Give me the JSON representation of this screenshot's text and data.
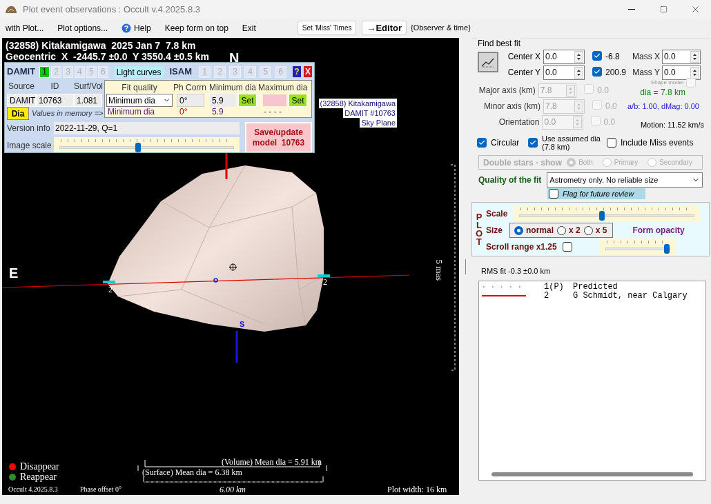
{
  "window": {
    "title": "Plot event observations : Occult v.4.2025.8.3"
  },
  "menu": [
    {
      "label": "with Plot...",
      "has_icon": false
    },
    {
      "label": "Plot options...",
      "has_icon": false
    },
    {
      "label": "Help",
      "has_icon": true
    },
    {
      "label": "Keep form on top",
      "has_icon": false
    },
    {
      "label": "Exit",
      "has_icon": false
    }
  ],
  "toolbar_buttons": [
    {
      "label": "Set 'Miss' Times",
      "bold": false
    },
    {
      "label": "→Editor",
      "bold": true
    }
  ],
  "observer_time_label": "{Observer & time}",
  "plot": {
    "header_lines": [
      "(32858) Kitakamigawa  2025 Jan 7  7.8 km",
      "Geocentric  X  -2445.7 ±0.0  Y 3550.4 ±0.5 km"
    ],
    "north": "N",
    "east": "E",
    "south": "S",
    "caption_lines": [
      "(32858) Kitakamigawa",
      "DAMIT #10763",
      "Sky Plane"
    ],
    "scale_side": "5 mas",
    "chord_labels": [
      "2",
      "2"
    ],
    "legend": [
      {
        "label": "Disappear",
        "color": "#ff0000"
      },
      {
        "label": "Reappear",
        "color": "#2e8b2e"
      }
    ],
    "volume_dia": "(Volume) Mean dia = 5.91 km",
    "surface_dia": "(Surface) Mean dia = 6.38 km",
    "version": "Occult 4.2025.8.3",
    "phase_offset": "Phase offset 0°",
    "scale_bar": "6.00 km",
    "plot_width": "Plot width: 16 km"
  },
  "shape_panel": {
    "damit_label": "DAMIT",
    "damit_models": [
      {
        "label": "1",
        "selected": true
      },
      {
        "label": "2",
        "selected": false
      },
      {
        "label": "3",
        "selected": false
      },
      {
        "label": "4",
        "selected": false
      },
      {
        "label": "5",
        "selected": false
      },
      {
        "label": "6",
        "selected": false
      }
    ],
    "light_curves": "Light curves",
    "isam_label": "ISAM",
    "isam_models": [
      {
        "label": "1",
        "selected": false
      },
      {
        "label": "2",
        "selected": false
      },
      {
        "label": "3",
        "selected": false
      },
      {
        "label": "4",
        "selected": false
      },
      {
        "label": "5",
        "selected": false
      },
      {
        "label": "6",
        "selected": false
      }
    ],
    "help": "?",
    "close": "X",
    "source": {
      "label": "Source",
      "value": "DAMIT"
    },
    "id": {
      "label": "ID",
      "value": "10763"
    },
    "surf_vol": {
      "label": "Surf/Vol",
      "value": "1.081"
    },
    "dia_button": "Dia",
    "memory_label": "Values in memory =>",
    "fit_quality": {
      "label": "Fit quality",
      "value": "Minimum dia",
      "memory": "Minimum dia"
    },
    "ph_corr": {
      "label": "Ph Corrn",
      "value": "0°",
      "memory": "0°"
    },
    "min_dia": {
      "label": "Minimum dia",
      "value": "5.9",
      "button": "Set",
      "memory": "5.9"
    },
    "max_dia": {
      "label": "Maximum dia",
      "button": "Set",
      "memory": "- - - -"
    },
    "version_info": {
      "label": "Version info",
      "value": "2022-11-29, Q=1"
    },
    "image_scale": {
      "label": "Image scale",
      "level": 0.45
    },
    "save_button": [
      "Save/update",
      "model  10763"
    ]
  },
  "fit": {
    "title": "Find best fit",
    "parameters": [
      {
        "label": "Center X",
        "value": "0.0",
        "checked": true,
        "result": "-6.8",
        "disabled": false
      },
      {
        "label": "Center Y",
        "value": "0.0",
        "checked": true,
        "result": "200.9",
        "disabled": false
      },
      {
        "label": "Major axis (km)",
        "value": "7.8",
        "checked": false,
        "result": "0.0",
        "disabled": true
      },
      {
        "label": "Minor axis (km)",
        "value": "7.8",
        "checked": false,
        "result": "0.0",
        "disabled": true
      },
      {
        "label": "Orientation",
        "value": "0.0",
        "checked": false,
        "result": "0.0",
        "disabled": true
      }
    ],
    "mass_fields": [
      {
        "label": "Mass X",
        "value": "0.0"
      },
      {
        "label": "Mass Y",
        "value": "0.0"
      }
    ],
    "shape_model": {
      "label": "Shape model",
      "checked": false
    },
    "dia_info": "dia = 7.8 km",
    "ab_info": "a/b: 1.00, dMag: 0.00",
    "motion": "Motion: 11.52 km/s",
    "options": [
      {
        "label": "Circular",
        "checked": true
      },
      {
        "label": "Use assumed dia (7.8 km)",
        "checked": true
      },
      {
        "label": "Include Miss events",
        "checked": false
      }
    ],
    "double_stars": {
      "label": "Double stars - show",
      "options": [
        {
          "label": "Both",
          "selected": true
        },
        {
          "label": "Primary",
          "selected": false
        },
        {
          "label": "Secondary",
          "selected": false
        }
      ]
    },
    "quality": {
      "label": "Quality of the fit",
      "value": "Astrometry only. No reliable size"
    },
    "flag": {
      "label": "Flag for future review",
      "checked": false
    }
  },
  "plot_controls": {
    "title": "PLOT",
    "scale": {
      "label": "Scale",
      "level": 0.47
    },
    "size": {
      "label": "Size",
      "options": [
        {
          "label": "normal",
          "selected": true
        },
        {
          "label": "x 2",
          "selected": false
        },
        {
          "label": "x 5",
          "selected": false
        }
      ]
    },
    "opacity": {
      "label": "Form opacity",
      "level": 1.0
    },
    "scroll": {
      "label": "Scroll range x1.25",
      "checked": false
    }
  },
  "rms": "RMS fit -0.3 ±0.0 km",
  "observers": [
    {
      "number": "1(P)",
      "name": "Predicted",
      "kind": "dotted"
    },
    {
      "number": "2",
      "name": "G Schmidt, near Calgary",
      "kind": "solid"
    }
  ]
}
